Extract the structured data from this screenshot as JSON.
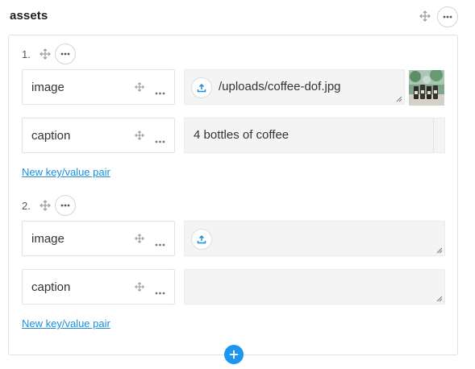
{
  "field": {
    "title": "assets",
    "move_icon": "move-arrows-icon",
    "more_icon": "more-horizontal-icon"
  },
  "items": [
    {
      "index": "1.",
      "pairs": [
        {
          "key": "image",
          "value": "/uploads/coffee-dof.jpg",
          "has_upload": true,
          "has_thumbnail": true
        },
        {
          "key": "caption",
          "value": "4 bottles of coffee",
          "has_upload": false,
          "has_thumbnail": false
        }
      ],
      "new_pair_label": "New key/value pair"
    },
    {
      "index": "2.",
      "pairs": [
        {
          "key": "image",
          "value": "",
          "has_upload": true,
          "has_thumbnail": false
        },
        {
          "key": "caption",
          "value": "",
          "has_upload": false,
          "has_thumbnail": false
        }
      ],
      "new_pair_label": "New key/value pair"
    }
  ],
  "colors": {
    "link": "#1a8fdd",
    "add_button": "#1e96f0",
    "upload_icon": "#1a8fdd"
  },
  "icons": {
    "upload": "upload-icon",
    "add": "plus-icon",
    "thumbnail": "coffee-thumbnail-image"
  }
}
